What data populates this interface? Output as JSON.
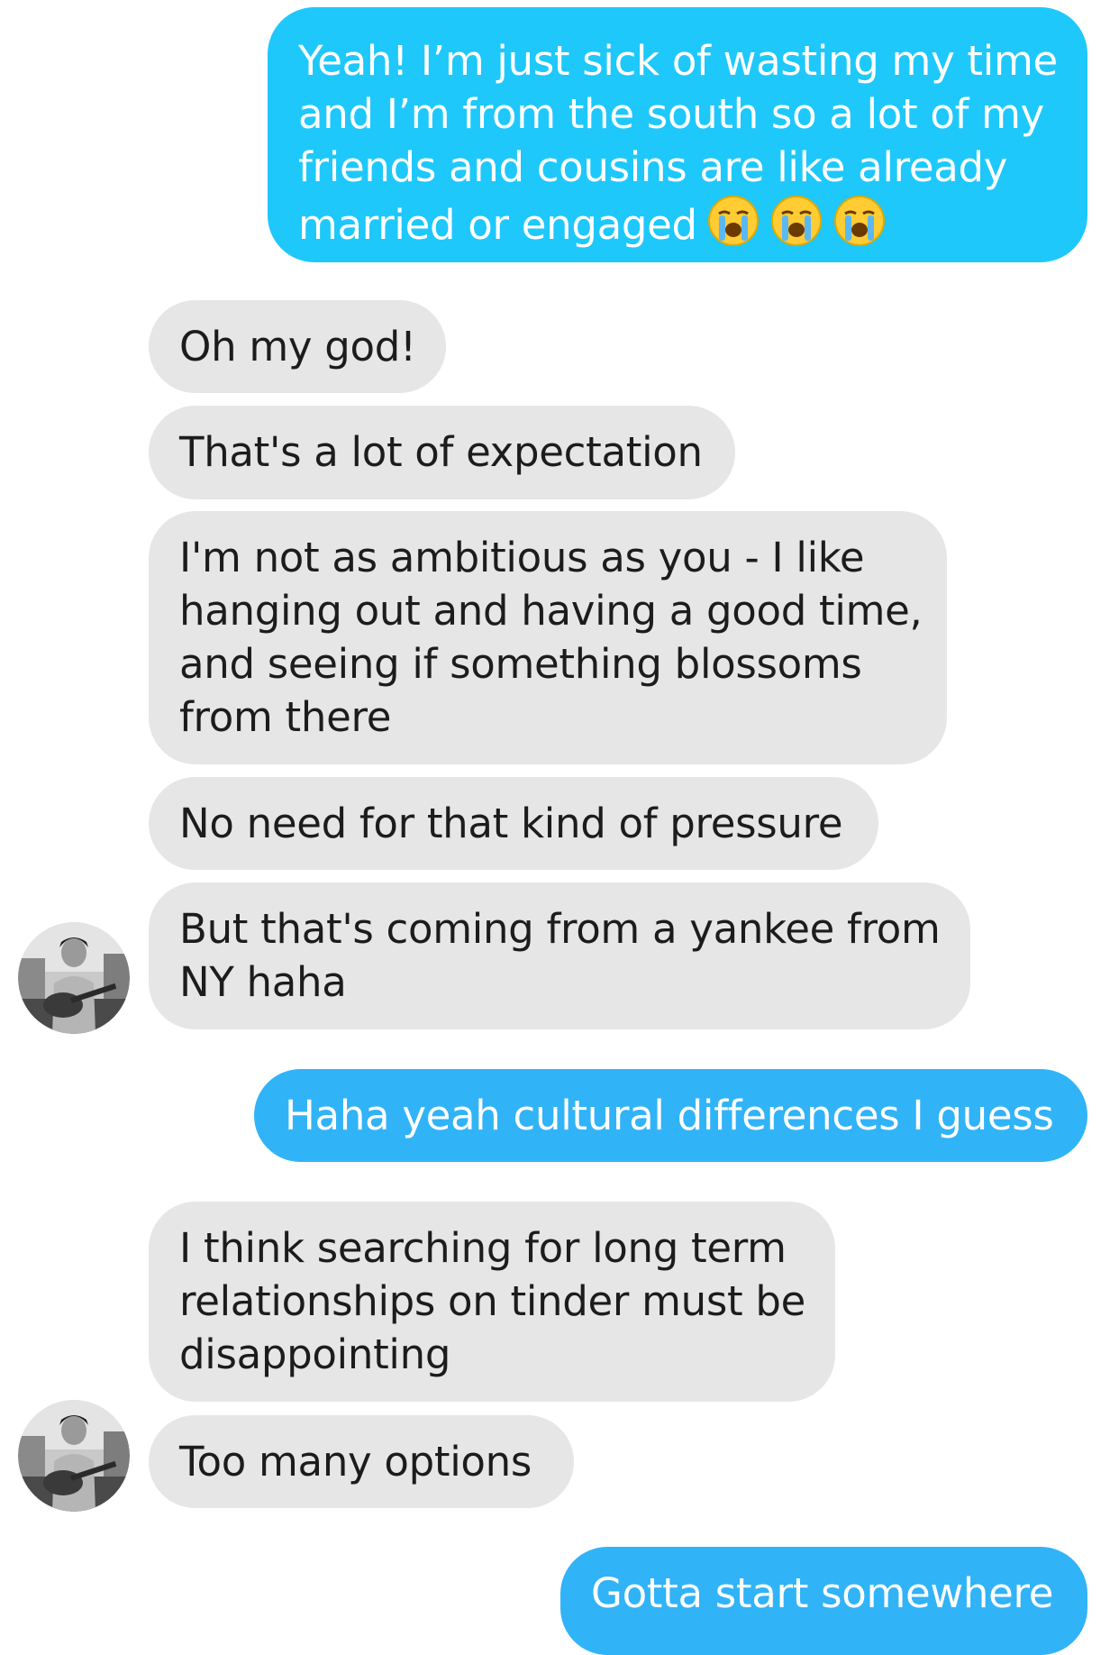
{
  "messages": [
    {
      "side": "sent",
      "lines": [
        "Yeah! I’m just sick of wasting my time",
        "and I’m from the south so a lot of my",
        "friends and cousins are like already",
        "married or engaged"
      ],
      "emoji": [
        "loudly-crying-face",
        "loudly-crying-face",
        "loudly-crying-face"
      ]
    },
    {
      "side": "received",
      "lines": [
        "Oh my god!"
      ]
    },
    {
      "side": "received",
      "lines": [
        "That's a lot of expectation"
      ]
    },
    {
      "side": "received",
      "lines": [
        "I'm not as ambitious as you - I like",
        "hanging out and having a good time,",
        "and seeing if something blossoms",
        "from there"
      ]
    },
    {
      "side": "received",
      "lines": [
        "No need for that kind of pressure"
      ]
    },
    {
      "side": "received",
      "lines": [
        "But that's coming from a yankee from",
        "NY haha"
      ]
    },
    {
      "side": "sent",
      "lines": [
        "Haha yeah cultural differences I guess"
      ]
    },
    {
      "side": "received",
      "lines": [
        "I think searching for long term",
        "relationships on tinder must be",
        "disappointing"
      ]
    },
    {
      "side": "received",
      "lines": [
        "Too many options"
      ]
    },
    {
      "side": "sent",
      "lines": [
        "Gotta start somewhere"
      ]
    }
  ],
  "colors": {
    "sent_bubble": "#1ec8fb",
    "sent_bubble_alt": "#31b3f7",
    "received_bubble": "#e6e6e6",
    "received_text": "#1c1c1c",
    "sent_text": "#ffffff"
  },
  "avatars": [
    "contact-avatar",
    "contact-avatar"
  ]
}
